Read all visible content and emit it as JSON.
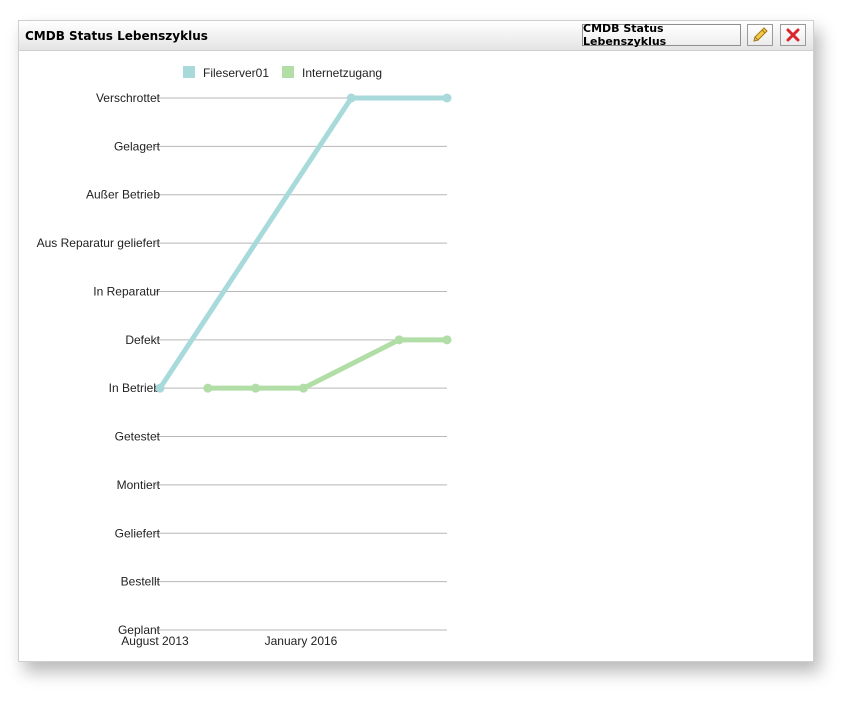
{
  "widget": {
    "title": "CMDB Status Lebenszyklus",
    "config_button_label": "CMDB Status Lebenszyklus"
  },
  "colors": {
    "fileserver": "#a8dadc",
    "internet": "#b1dea6",
    "gridline": "#b7b7b7"
  },
  "chart_data": {
    "type": "line",
    "y_categories": [
      "Geplant",
      "Bestellt",
      "Geliefert",
      "Montiert",
      "Getestet",
      "In Betrieb",
      "Defekt",
      "In Reparatur",
      "Aus Reparatur geliefert",
      "Außer Betrieb",
      "Gelagert",
      "Verschrottet"
    ],
    "x_tick_labels": [
      "August 2013",
      "January 2016"
    ],
    "series": [
      {
        "name": "Fileserver01",
        "x_index": [
          0,
          4,
          6
        ],
        "y": [
          "In Betrieb",
          "Verschrottet",
          "Verschrottet"
        ],
        "color": "#a8dadc"
      },
      {
        "name": "Internetzugang",
        "x_index": [
          1,
          2,
          3,
          5,
          6
        ],
        "y": [
          "In Betrieb",
          "In Betrieb",
          "In Betrieb",
          "Defekt",
          "Defekt"
        ],
        "color": "#b1dea6"
      }
    ],
    "legend_position": "top",
    "grid": true
  }
}
